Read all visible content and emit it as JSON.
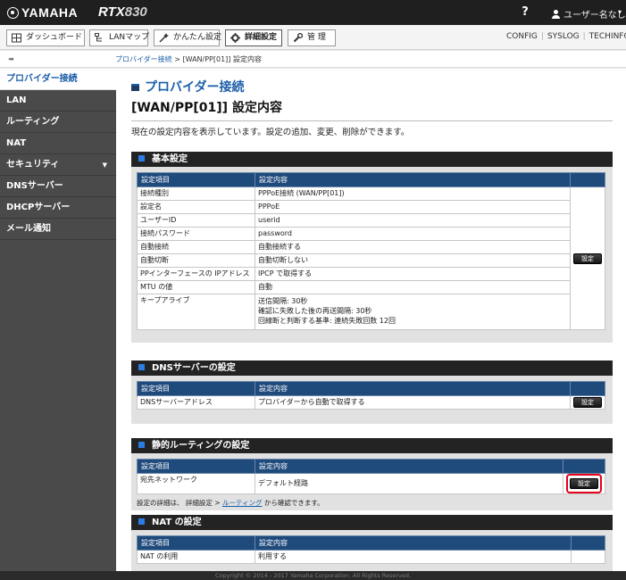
{
  "header": {
    "brand": "YAMAHA",
    "model_prefix": "RTX",
    "model_number": "830",
    "help": "?",
    "user": "ユーザー名なし",
    "caret": "▾"
  },
  "nav": {
    "buttons": [
      {
        "label": "ダッシュボード",
        "icon": "dashboard-icon"
      },
      {
        "label": "LANマップ",
        "icon": "lan-map-icon"
      },
      {
        "label": "かんたん設定",
        "icon": "wizard-icon"
      },
      {
        "label": "詳細設定",
        "icon": "gear-icon"
      },
      {
        "label": "管 理",
        "icon": "wrench-icon"
      }
    ],
    "right_links": [
      "CONFIG",
      "SYSLOG",
      "TECHINFO"
    ]
  },
  "breadcrumb": {
    "collapse": "◂◂",
    "link": "プロバイダー接続",
    "sep": " > ",
    "current": "[WAN/PP[01]] 設定内容"
  },
  "sidebar": {
    "items": [
      {
        "label": "プロバイダー接続"
      },
      {
        "label": "LAN"
      },
      {
        "label": "ルーティング"
      },
      {
        "label": "NAT"
      },
      {
        "label": "セキュリティ",
        "arrow": "▼"
      },
      {
        "label": "DNSサーバー"
      },
      {
        "label": "DHCPサーバー"
      },
      {
        "label": "メール通知"
      }
    ]
  },
  "page": {
    "title": "プロバイダー接続",
    "subtitle": "[WAN/PP[01]] 設定内容",
    "description": "現在の設定内容を表示しています。設定の追加、変更、削除ができます。"
  },
  "sections": {
    "basic": {
      "title": "基本設定",
      "col1": "設定項目",
      "col2": "設定内容",
      "rows": [
        [
          "接続種別",
          "PPPoE接続 (WAN/PP[01])"
        ],
        [
          "設定名",
          "PPPoE"
        ],
        [
          "ユーザーID",
          "userid"
        ],
        [
          "接続パスワード",
          "password"
        ],
        [
          "自動接続",
          "自動接続する"
        ],
        [
          "自動切断",
          "自動切断しない"
        ],
        [
          "PPインターフェースの IPアドレス",
          "IPCP で取得する"
        ],
        [
          "MTU の値",
          "自動"
        ]
      ],
      "keepalive_label": "キープアライブ",
      "keepalive_lines": [
        "送信間隔: 30秒",
        "確認に失敗した後の再送間隔: 30秒",
        "回線断と判断する基準: 連続失敗回数 12回"
      ],
      "button": "設定"
    },
    "dns": {
      "title": "DNSサーバーの設定",
      "col1": "設定項目",
      "col2": "設定内容",
      "row": [
        "DNSサーバーアドレス",
        "プロバイダーから自動で取得する"
      ],
      "button": "設定"
    },
    "static": {
      "title": "静的ルーティングの設定",
      "col1": "設定項目",
      "col2": "設定内容",
      "row": [
        "宛先ネットワーク",
        "デフォルト経路"
      ],
      "button": "設定",
      "note_prefix": "設定の詳細は、 詳細設定 > ",
      "note_link": "ルーティング",
      "note_suffix": " から確認できます。"
    },
    "nat": {
      "title": "NAT の設定",
      "col1": "設定項目",
      "col2": "設定内容",
      "row": [
        "NAT の利用",
        "利用する"
      ]
    }
  },
  "footer": "Copyright © 2014 - 2017 Yamaha Corporation. All Rights Reserved."
}
